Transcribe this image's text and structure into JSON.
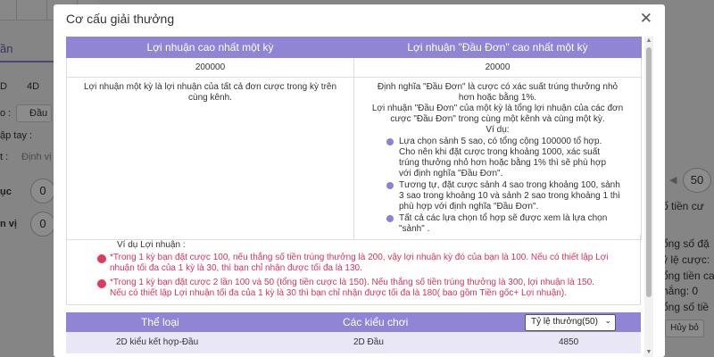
{
  "background": {
    "tab_label": "ần",
    "opt_d": "D",
    "opt_4d": "4D",
    "filter_prefix": "o :",
    "filter_value": "Đầu",
    "manual_label": "ập tay :",
    "position_label": "t :",
    "position_value": "Định vị",
    "field_a_label": "ục",
    "field_a_value": "0",
    "field_b_label": "n vị",
    "field_b_value": "0",
    "right_prev": "◀",
    "right_amount": "50",
    "right_text_1": "ố tiền cư",
    "right_text_2": "ổng số đặ",
    "right_text_3": "ỷ lệ cược:",
    "right_text_4": "ổng tiền cac",
    "right_text_5": "hắng: 0",
    "right_text_6": "ổng số tiề",
    "right_cancel": "Hủy bỏ"
  },
  "modal": {
    "title": "Cơ cấu giải thưởng",
    "close_icon": "close-icon"
  },
  "prize_table": {
    "headers": [
      "Lợi nhuận cao nhất một kỳ",
      "Lợi nhuận \"Đầu Đơn\" cao nhất một kỳ"
    ],
    "values": [
      "200000",
      "20000"
    ],
    "left_desc": "Lợi nhuận một kỳ là lợi nhuận của tất cả đơn cược trong kỳ trên cùng kênh.",
    "right_desc_lines": [
      "Định nghĩa \"Đầu Đơn\" là cược có xác suất trúng thưởng nhỏ",
      "hơn hoặc bằng 1%.",
      "Lợi nhuận \"Đầu Đơn\" của một kỳ là tổng lợi nhuận của các đơn",
      "cược \"Đầu Đơn\" trong cùng một kênh và cùng một kỳ."
    ],
    "example_label": "Ví dụ:",
    "bullets": [
      "Lựa chọn sảnh 5 sao, có tổng cộng 100000 tổ hợp. Cho nên khi đặt cược trong khoảng 1000, xác suất trúng thưởng nhỏ hơn hoặc bằng 1% thì sẽ phù hợp với định nghĩa \"Đầu Đơn\".",
      "Tương tự, đặt cược sảnh 4 sao trong khoảng 100, sảnh 3 sao trong khoảng 10 và sảnh 2 sao trong khoảng 1 thì phù hợp với định nghĩa \"Đầu Đơn\".",
      "Tất cả các lựa chọn tổ hợp sẽ được xem là lựa chọn \"sảnh\" ."
    ]
  },
  "profit_example": {
    "title": "Ví dụ Lợi nhuận :",
    "items": [
      "*Trong 1 kỳ bạn đặt cược 100, nếu thắng số tiền trúng thưởng là 200, vậy lợi nhuận kỳ đó của bạn là 100. Nếu có thiết lập Lợi nhuận tối đa của 1 kỳ là 30, thì bạn chỉ nhận được tối đa là 130.",
      "*Trong 1 kỳ bạn đặt cược 2 lần 100 và 50 (tổng tiền cược là 150). Nếu thắng số tiền trúng thưởng là 300, lợi nhuận là 150. Nếu có thiết lập Lợi nhuận tối đa của 1 kỳ là 30 thì bạn chỉ nhận được tối đa là 180( bao gồm Tiền gốc+ Lợi nhuận)."
    ]
  },
  "game_types": {
    "col_type": "Thể loại",
    "col_play": "Các kiểu chơi",
    "odds_select": "Tỷ lệ thưởng(50)",
    "rows": [
      {
        "type": "2D kiểu kết hợp-Đầu",
        "play": "2D Đầu",
        "odds": "4850"
      }
    ]
  }
}
